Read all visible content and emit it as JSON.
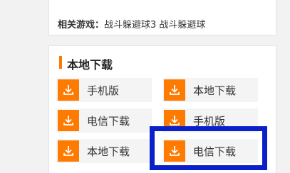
{
  "related": {
    "label": "相关游戏：",
    "games": "战斗躲避球3 战斗躲避球"
  },
  "download_section": {
    "title": "本地下载",
    "buttons": [
      {
        "label": "手机版"
      },
      {
        "label": "本地下载"
      },
      {
        "label": "电信下载"
      },
      {
        "label": "手机版"
      },
      {
        "label": "本地下载"
      },
      {
        "label": "电信下载"
      }
    ]
  },
  "colors": {
    "accent": "#ff7a00",
    "highlight_border": "#0a20c9"
  },
  "icons": {
    "download": "download-icon"
  }
}
